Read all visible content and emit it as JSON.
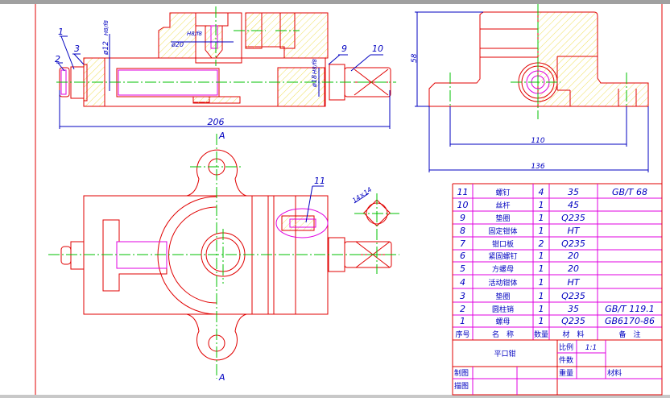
{
  "drawing": {
    "title": "平口钳",
    "colors": {
      "outline": "#e00000",
      "centerline": "#00c000",
      "dimension": "#0000c0",
      "hatch": "#f0e060",
      "table_lines": "#e000e0"
    },
    "front_view": {
      "leaders": [
        "1",
        "2",
        "3",
        "9",
        "10"
      ],
      "dims": {
        "overall_length": "206",
        "d1": "ø12",
        "d2": "ø20",
        "d3": "ø18"
      },
      "fits": {
        "f1": "H8/f8",
        "f2": "H8/f8",
        "f3": "H8/f8"
      }
    },
    "side_view": {
      "height": "58",
      "hole_spacing": "110",
      "base_width": "136"
    },
    "top_view": {
      "section_mark_top": "A",
      "section_mark_bottom": "A",
      "leader": "11",
      "square": "14×14"
    }
  },
  "parts_table": {
    "rows": [
      {
        "no": "11",
        "name": "螺钉",
        "qty": "4",
        "material": "35",
        "note": "GB/T 68"
      },
      {
        "no": "10",
        "name": "丝杆",
        "qty": "1",
        "material": "45",
        "note": ""
      },
      {
        "no": "9",
        "name": "垫圈",
        "qty": "1",
        "material": "Q235",
        "note": ""
      },
      {
        "no": "8",
        "name": "固定钳体",
        "qty": "1",
        "material": "HT",
        "note": ""
      },
      {
        "no": "7",
        "name": "钳口板",
        "qty": "2",
        "material": "Q235",
        "note": ""
      },
      {
        "no": "6",
        "name": "紧固螺钉",
        "qty": "1",
        "material": "20",
        "note": ""
      },
      {
        "no": "5",
        "name": "方螺母",
        "qty": "1",
        "material": "20",
        "note": ""
      },
      {
        "no": "4",
        "name": "活动钳体",
        "qty": "1",
        "material": "HT",
        "note": ""
      },
      {
        "no": "3",
        "name": "垫圈",
        "qty": "1",
        "material": "Q235",
        "note": ""
      },
      {
        "no": "2",
        "name": "圆柱销",
        "qty": "1",
        "material": "35",
        "note": "GB/T 119.1"
      },
      {
        "no": "1",
        "name": "螺母",
        "qty": "1",
        "material": "Q235",
        "note": "GB6170-86"
      }
    ],
    "headers": {
      "no": "序号",
      "name": "名　称",
      "qty": "数量",
      "material": "材　料",
      "note": "备　注"
    }
  },
  "title_block": {
    "name": "平口钳",
    "scale_label": "比例",
    "scale_value": "1:1",
    "count_label": "件数",
    "weight_label": "重量",
    "material_label": "材料",
    "drawn_label": "制图",
    "traced_label": "描图"
  }
}
